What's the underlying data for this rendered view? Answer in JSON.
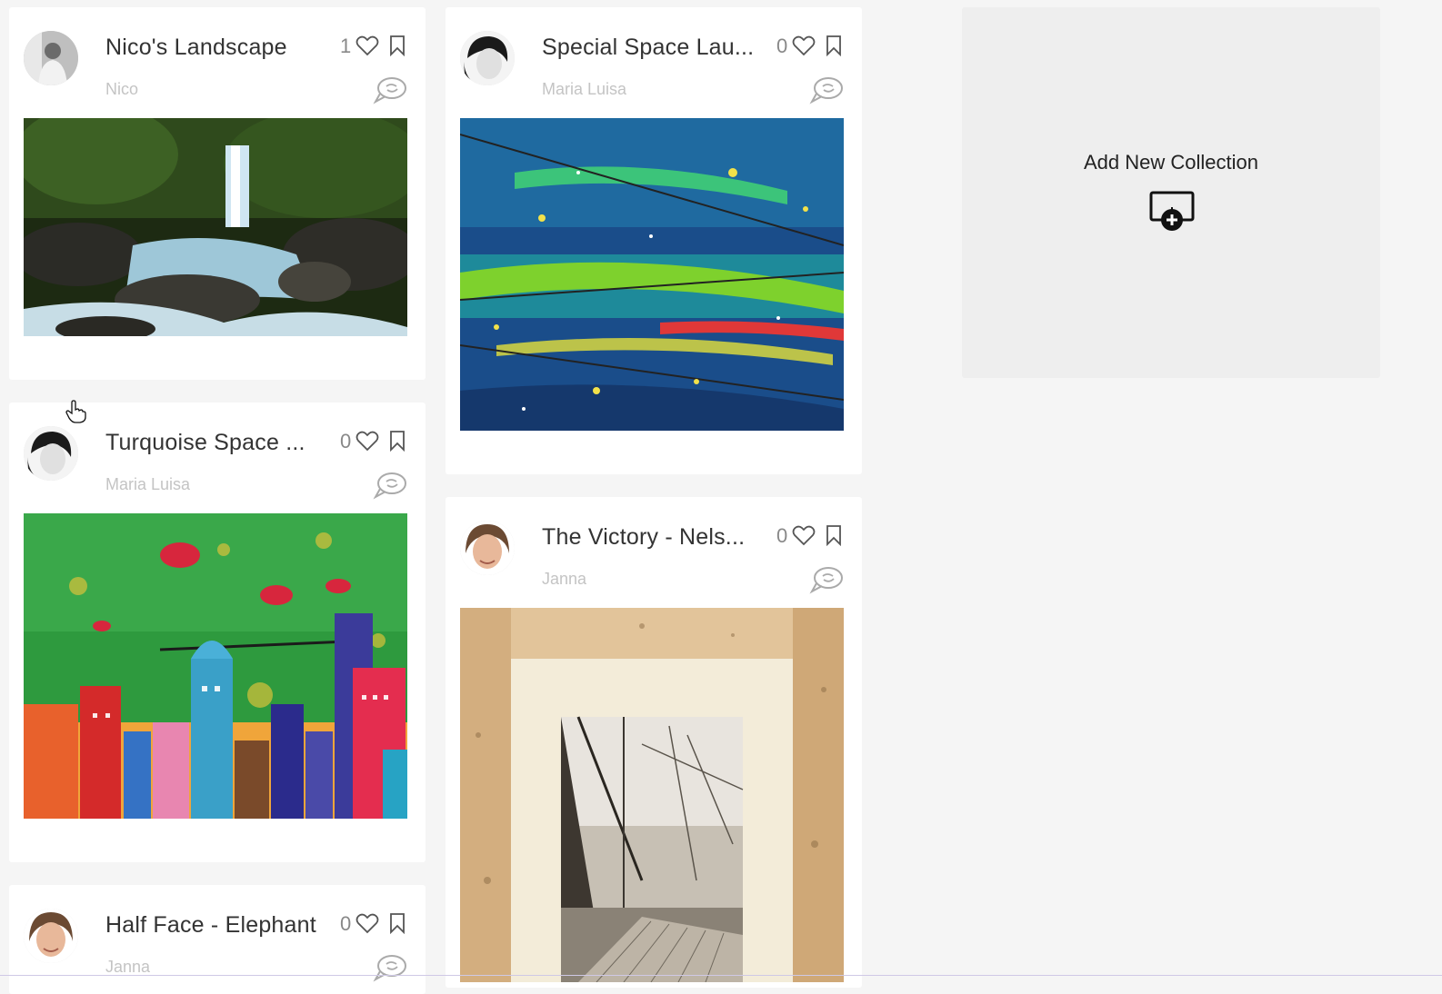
{
  "cards": [
    {
      "title": "Nico's Landscape",
      "author": "Nico",
      "likes": "1"
    },
    {
      "title": "Special Space Lau...",
      "author": "Maria Luisa",
      "likes": "0"
    },
    {
      "title": "Turquoise Space ...",
      "author": "Maria Luisa",
      "likes": "0"
    },
    {
      "title": "The Victory - Nels...",
      "author": "Janna",
      "likes": "0"
    },
    {
      "title": "Half Face - Elephant",
      "author": "Janna",
      "likes": "0"
    }
  ],
  "add_collection": {
    "label": "Add New Collection"
  },
  "icons": {
    "like": "heart-icon",
    "save": "bookmark-icon",
    "comment": "comment-icon",
    "add": "add-collection-icon",
    "cursor": "hand-cursor-icon"
  },
  "colors": {
    "page_background": "#f5f5f5",
    "card_background": "#ffffff",
    "add_box_background": "#eeeeee",
    "title_text": "#333333",
    "author_text": "#c4c4c4"
  }
}
